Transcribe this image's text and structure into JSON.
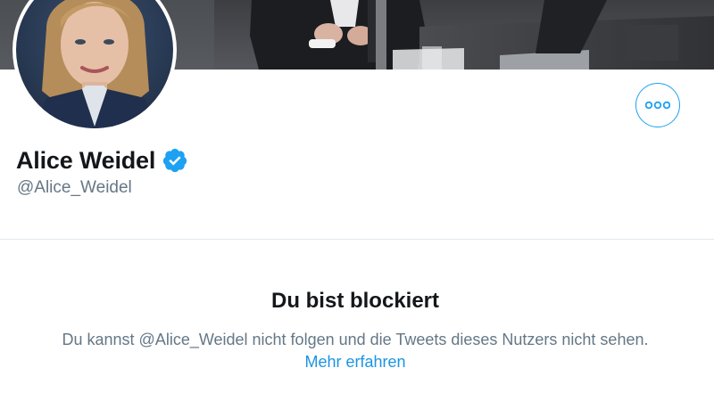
{
  "profile": {
    "display_name": "Alice Weidel",
    "handle": "@Alice_Weidel",
    "verified": true,
    "avatar_icon": "profile-photo",
    "banner_icon": "banner-photo"
  },
  "actions": {
    "more_icon": "more-horizontal-icon"
  },
  "blocked": {
    "title": "Du bist blockiert",
    "description": "Du kannst @Alice_Weidel nicht folgen und die Tweets dieses Nutzers nicht sehen.",
    "learn_more": "Mehr erfahren"
  },
  "colors": {
    "accent": "#1da1f2",
    "link": "#1b95e0",
    "text_primary": "#14171a",
    "text_secondary": "#657786",
    "divider": "#e1e8ed"
  }
}
